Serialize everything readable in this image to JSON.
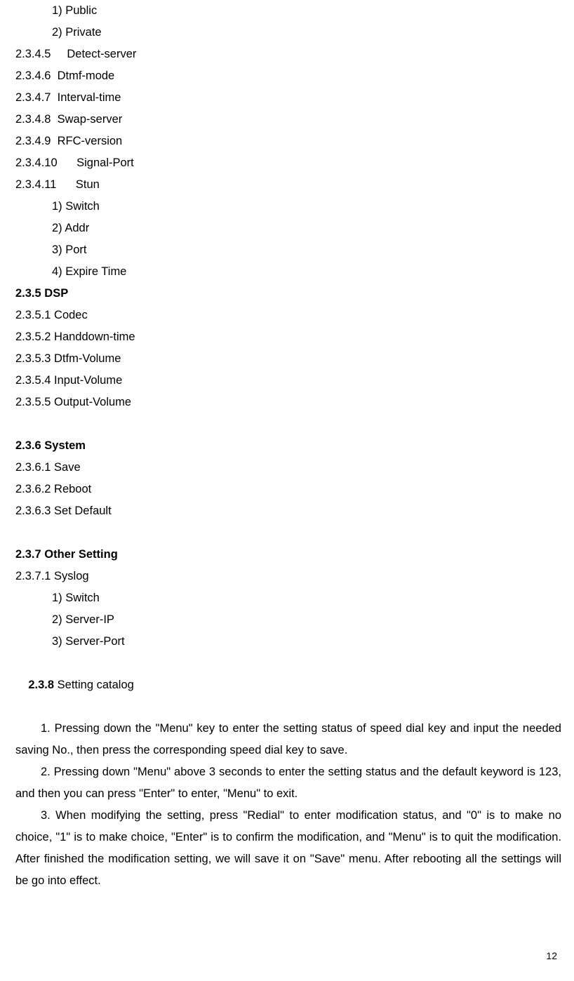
{
  "lines": {
    "l01": "1) Public",
    "l02": "2) Private",
    "l03": "2.3.4.5     Detect-server",
    "l04": "2.3.4.6  Dtmf-mode",
    "l05": "2.3.4.7  Interval-time",
    "l06": "2.3.4.8  Swap-server",
    "l07": "2.3.4.9  RFC-version",
    "l08": "2.3.4.10      Signal-Port",
    "l09": "2.3.4.11      Stun",
    "l10": "1) Switch",
    "l11": "2) Addr",
    "l12": "3) Port",
    "l13": "4) Expire Time",
    "h14": "2.3.5 DSP",
    "l15": "2.3.5.1 Codec",
    "l16": "2.3.5.2 Handdown-time",
    "l17": "2.3.5.3 Dtfm-Volume",
    "l18": "2.3.5.4 Input-Volume",
    "l19": "2.3.5.5 Output-Volume",
    "h20": "2.3.6 System",
    "l21": "2.3.6.1 Save",
    "l22": "2.3.6.2 Reboot",
    "l23": "2.3.6.3 Set Default",
    "h24": "2.3.7 Other Setting",
    "l25": "2.3.7.1 Syslog",
    "l26": "1) Switch",
    "l27": "2) Server-IP",
    "l28": "3) Server-Port",
    "h29a": "2.3.8",
    "h29b": " Setting catalog",
    "p1": "1. Pressing down the \"Menu\" key to enter the setting status of speed dial key and input the needed saving No., then press the corresponding speed dial key to save.",
    "p2": "2. Pressing down \"Menu\" above 3 seconds to enter the setting status and the default keyword is 123, and then you can press \"Enter\" to enter, \"Menu\" to exit.",
    "p3": "3. When modifying the setting, press \"Redial\" to enter modification status, and \"0\" is to make no choice, \"1\" is to make choice, \"Enter\" is to confirm the modification, and \"Menu\" is to quit the modification. After finished the modification setting, we will save it on \"Save\" menu. After rebooting all the settings will be go into effect."
  },
  "page_number": "12"
}
